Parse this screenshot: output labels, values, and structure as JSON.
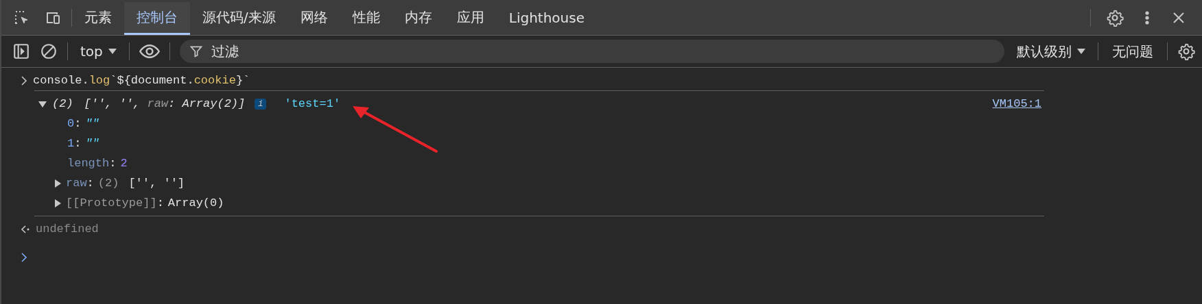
{
  "tabs": [
    {
      "label": "元素",
      "selected": false
    },
    {
      "label": "控制台",
      "selected": true
    },
    {
      "label": "源代码/来源",
      "selected": false
    },
    {
      "label": "网络",
      "selected": false
    },
    {
      "label": "性能",
      "selected": false
    },
    {
      "label": "内存",
      "selected": false
    },
    {
      "label": "应用",
      "selected": false
    },
    {
      "label": "Lighthouse",
      "selected": false
    }
  ],
  "toolbar": {
    "context": "top",
    "filter": {
      "placeholder": "过滤"
    },
    "log_level": "默认级别",
    "issues": "无问题"
  },
  "console": {
    "input": [
      {
        "text": "console.",
        "kind": "plain"
      },
      {
        "text": "log",
        "kind": "name"
      },
      {
        "text": "`${document.",
        "kind": "plain"
      },
      {
        "text": "cookie",
        "kind": "name"
      },
      {
        "text": "}`",
        "kind": "plain"
      }
    ],
    "entry": {
      "expanded": true,
      "count": "(2)",
      "summary": [
        {
          "text": "['', '', ",
          "kind": "plain"
        },
        {
          "text": "raw",
          "kind": "dim"
        },
        {
          "text": ": Array(2)]",
          "kind": "plain"
        }
      ],
      "badge": "i",
      "message": "'test=1'",
      "source": "VM105:1",
      "properties": [
        {
          "key": "0",
          "separator": ":",
          "kind": "string",
          "value": "\"\""
        },
        {
          "key": "1",
          "separator": ":",
          "kind": "string",
          "value": "\"\""
        },
        {
          "key": "length",
          "separator": ":",
          "kind": "number",
          "value": "2"
        },
        {
          "key": "raw",
          "separator": ":",
          "kind": "array",
          "count": "(2)",
          "value": "['', '']",
          "expanded": false
        },
        {
          "key": "[[Prototype]]",
          "separator": ":",
          "kind": "prototype",
          "value": "Array(0)",
          "expanded": false
        }
      ]
    },
    "result": "undefined"
  }
}
